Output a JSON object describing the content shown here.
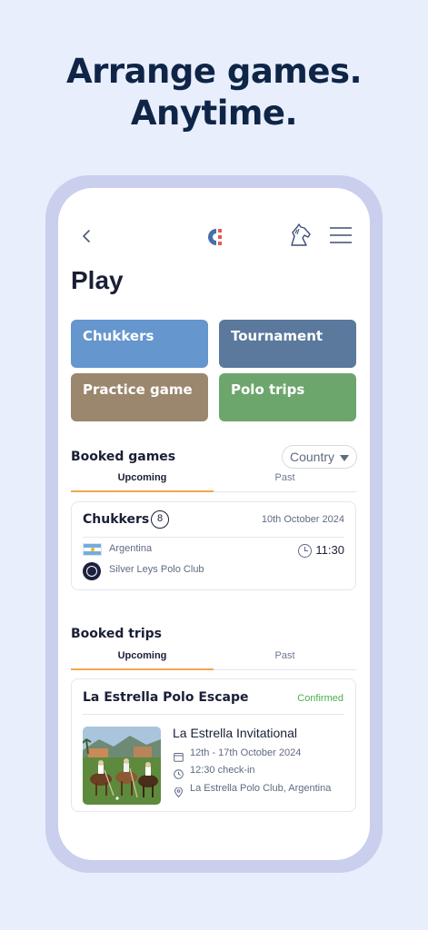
{
  "headline": {
    "line1": "Arrange games.",
    "line2": "Anytime."
  },
  "icons": {
    "back": "chevron-left-icon",
    "logo": "club-logo-icon",
    "horse": "horse-head-icon",
    "menu": "hamburger-menu-icon",
    "clock": "clock-icon",
    "calendar": "calendar-icon",
    "location": "location-pin-icon"
  },
  "page": {
    "title": "Play"
  },
  "play_options": [
    {
      "label": "Chukkers",
      "color": "#6596cd"
    },
    {
      "label": "Tournament",
      "color": "#5b789d"
    },
    {
      "label": "Practice game",
      "color": "#9a876d"
    },
    {
      "label": "Polo trips",
      "color": "#6da66d"
    }
  ],
  "booked_games": {
    "title": "Booked games",
    "filter": "Country",
    "tabs": {
      "upcoming": "Upcoming",
      "past": "Past"
    },
    "items": [
      {
        "name": "Chukkers",
        "count": "8",
        "date": "10th October 2024",
        "country": "Argentina",
        "club": "Silver Leys Polo Club",
        "time": "11:30"
      }
    ]
  },
  "booked_trips": {
    "title": "Booked trips",
    "tabs": {
      "upcoming": "Upcoming",
      "past": "Past"
    },
    "items": [
      {
        "name": "La Estrella Polo Escape",
        "status": "Confirmed",
        "event": "La Estrella Invitational",
        "dates": "12th - 17th October 2024",
        "checkin": "12:30 check-in",
        "location": "La Estrella Polo Club, Argentina"
      }
    ]
  },
  "colors": {
    "accent_tab": "#f2a64e",
    "confirmed": "#4caf50",
    "frame": "#c9cfed",
    "background": "#e8eefb"
  }
}
